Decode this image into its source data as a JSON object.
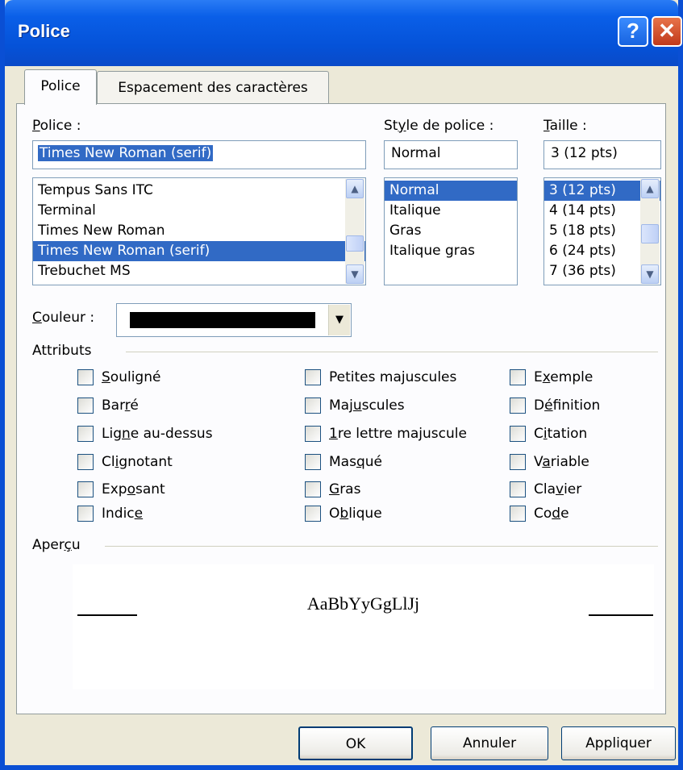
{
  "window": {
    "title": "Police",
    "help_glyph": "?",
    "close_glyph": "✕"
  },
  "tabs": [
    {
      "label": "Police"
    },
    {
      "label": "Espacement des caractères"
    }
  ],
  "font": {
    "label": "Police :",
    "value": "Times New Roman (serif)",
    "items": [
      "Tempus Sans ITC",
      "Terminal",
      "Times New Roman",
      "Times New Roman (serif)",
      "Trebuchet MS"
    ],
    "selected": "Times New Roman (serif)"
  },
  "style": {
    "label": "Style de police :",
    "value": "Normal",
    "items": [
      "Normal",
      "Italique",
      "Gras",
      "Italique gras"
    ],
    "selected": "Normal"
  },
  "size": {
    "label": "Taille :",
    "value": "3  (12 pts)",
    "items": [
      "3  (12 pts)",
      "4  (14 pts)",
      "5  (18 pts)",
      "6  (24 pts)",
      "7  (36 pts)"
    ],
    "selected": "3  (12 pts)"
  },
  "color": {
    "label": "Couleur :",
    "value_hex": "#000000"
  },
  "attributes": {
    "label": "Attributs",
    "col1": [
      "Souligné",
      "Barré",
      "Ligne au-dessus",
      "Clignotant",
      "Exposant",
      "Indice"
    ],
    "col2": [
      "Petites majuscules",
      "Majuscules",
      "1re lettre majuscule",
      "Masqué",
      "Gras",
      "Oblique"
    ],
    "col3": [
      "Exemple",
      "Définition",
      "Citation",
      "Variable",
      "Clavier",
      "Code"
    ]
  },
  "preview": {
    "label": "Aperçu",
    "sample": "AaBbYyGgLlJj"
  },
  "buttons": {
    "ok": "OK",
    "cancel": "Annuler",
    "apply": "Appliquer"
  },
  "colors": {
    "titlebar": "#0a5fe8",
    "selection": "#316ac5",
    "dialog_bg": "#ece9d8"
  }
}
